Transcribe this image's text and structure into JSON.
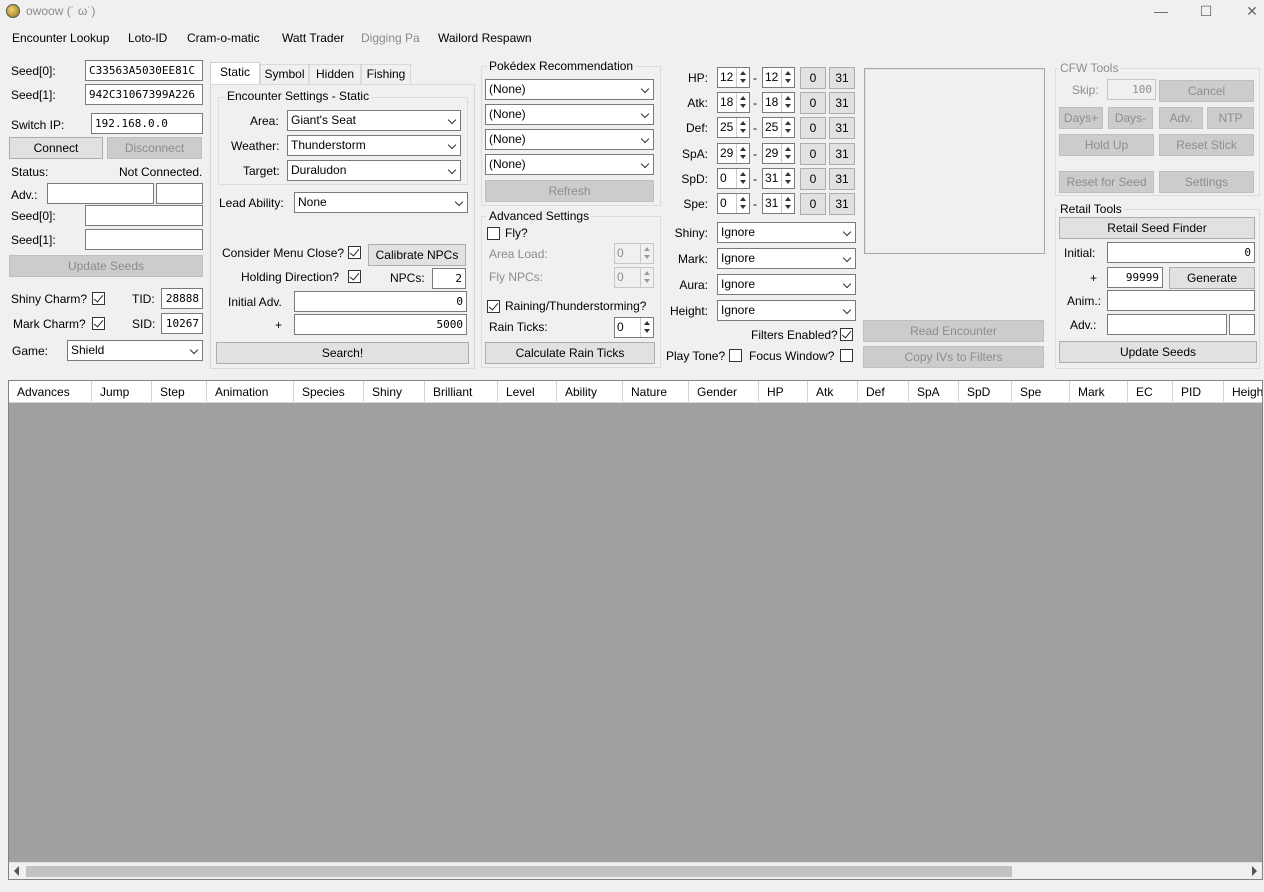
{
  "window": {
    "title": "owoow (˙ ω˙)",
    "minimize": "—",
    "maximize": "☐",
    "close": "✕"
  },
  "menu": [
    "Encounter Lookup",
    "Loto-ID",
    "Cram-o-matic",
    "Watt Trader",
    "Digging Pa",
    "Wailord Respawn"
  ],
  "connection": {
    "seed0_label": "Seed[0]:",
    "seed0_value": "C33563A5030EE81C",
    "seed1_label": "Seed[1]:",
    "seed1_value": "942C31067399A226",
    "switch_ip_label": "Switch IP:",
    "switch_ip_value": "192.168.0.0",
    "connect": "Connect",
    "disconnect": "Disconnect",
    "status_label": "Status:",
    "status_value": "Not Connected.",
    "adv_label": "Adv.:",
    "seed0b_label": "Seed[0]:",
    "seed1b_label": "Seed[1]:",
    "update_seeds": "Update Seeds"
  },
  "profile": {
    "shiny_charm": "Shiny Charm?",
    "mark_charm": "Mark Charm?",
    "tid_label": "TID:",
    "tid_value": "28888",
    "sid_label": "SID:",
    "sid_value": "10267",
    "game_label": "Game:",
    "game_value": "Shield"
  },
  "tabs": [
    "Static",
    "Symbol",
    "Hidden",
    "Fishing"
  ],
  "encounter": {
    "group_title": "Encounter Settings - Static",
    "area_label": "Area:",
    "area_value": "Giant's Seat",
    "weather_label": "Weather:",
    "weather_value": "Thunderstorm",
    "target_label": "Target:",
    "target_value": "Duraludon",
    "lead_label": "Lead Ability:",
    "lead_value": "None",
    "menu_close": "Consider Menu Close?",
    "calibrate": "Calibrate NPCs",
    "holding": "Holding Direction?",
    "npcs_label": "NPCs:",
    "npcs_value": "2",
    "initial_label": "Initial Adv.",
    "initial_value": "0",
    "plus_label": "+",
    "plus_value": "5000",
    "search": "Search!"
  },
  "pokedex": {
    "title": "Pokédex Recommendation",
    "options": [
      "(None)",
      "(None)",
      "(None)",
      "(None)"
    ],
    "refresh": "Refresh"
  },
  "advanced": {
    "title": "Advanced Settings",
    "fly": "Fly?",
    "area_load_label": "Area Load:",
    "area_load_value": "0",
    "fly_npcs_label": "Fly NPCs:",
    "fly_npcs_value": "0",
    "raining": "Raining/Thunderstorming?",
    "rain_ticks_label": "Rain Ticks:",
    "rain_ticks_value": "0",
    "calc": "Calculate Rain Ticks"
  },
  "ivs": [
    {
      "label": "HP:",
      "min": "12",
      "max": "12"
    },
    {
      "label": "Atk:",
      "min": "18",
      "max": "18"
    },
    {
      "label": "Def:",
      "min": "25",
      "max": "25"
    },
    {
      "label": "SpA:",
      "min": "29",
      "max": "29"
    },
    {
      "label": "SpD:",
      "min": "0",
      "max": "31"
    },
    {
      "label": "Spe:",
      "min": "0",
      "max": "31"
    }
  ],
  "iv_dash": "-",
  "iv_zero": "0",
  "iv_max": "31",
  "filters": {
    "shiny_label": "Shiny:",
    "shiny_value": "Ignore",
    "mark_label": "Mark:",
    "mark_value": "Ignore",
    "aura_label": "Aura:",
    "aura_value": "Ignore",
    "height_label": "Height:",
    "height_value": "Ignore",
    "filters_enabled": "Filters Enabled?",
    "play_tone": "Play Tone?",
    "focus_window": "Focus Window?"
  },
  "preview_actions": {
    "read": "Read Encounter",
    "copy": "Copy IVs to Filters"
  },
  "cfw": {
    "title": "CFW Tools",
    "skip_label": "Skip:",
    "skip_value": "100",
    "cancel": "Cancel",
    "days_plus": "Days+",
    "days_minus": "Days-",
    "adv": "Adv.",
    "ntp": "NTP",
    "hold_up": "Hold Up",
    "reset_stick": "Reset Stick",
    "reset_for_seed": "Reset for Seed",
    "settings": "Settings"
  },
  "retail": {
    "title": "Retail Tools",
    "finder": "Retail Seed Finder",
    "initial_label": "Initial:",
    "initial_value": "0",
    "plus_label": "+",
    "plus_value": "99999",
    "generate": "Generate",
    "anim_label": "Anim.:",
    "adv_label": "Adv.:",
    "update": "Update Seeds"
  },
  "columns": [
    "Advances",
    "Jump",
    "Step",
    "Animation",
    "Species",
    "Shiny",
    "Brilliant",
    "Level",
    "Ability",
    "Nature",
    "Gender",
    "HP",
    "Atk",
    "Def",
    "SpA",
    "SpD",
    "Spe",
    "Mark",
    "EC",
    "PID",
    "Height"
  ]
}
